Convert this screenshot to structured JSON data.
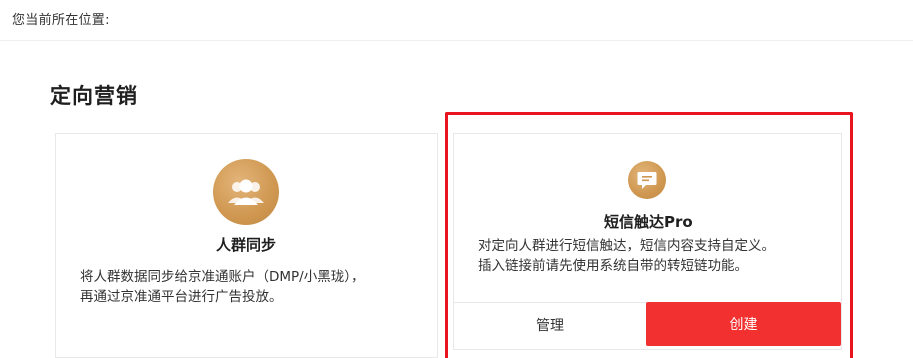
{
  "breadcrumb": {
    "label": "您当前所在位置:"
  },
  "section": {
    "title": "定向营销"
  },
  "cards": {
    "sync": {
      "icon": "users-icon",
      "title": "人群同步",
      "desc_line1": "将人群数据同步给京准通账户（DMP/小黑珑），",
      "desc_line2": "再通过京准通平台进行广告投放。"
    },
    "sms": {
      "icon": "message-icon",
      "title": "短信触达Pro",
      "desc_line1": "对定向人群进行短信触达，短信内容支持自定义。",
      "desc_line2": "插入链接前请先使用系统自带的转短链功能。",
      "manage_label": "管理",
      "create_label": "创建"
    }
  },
  "colors": {
    "accent_red": "#f23030",
    "highlight_red": "#e8141e",
    "icon_gold": "#cf9750"
  }
}
